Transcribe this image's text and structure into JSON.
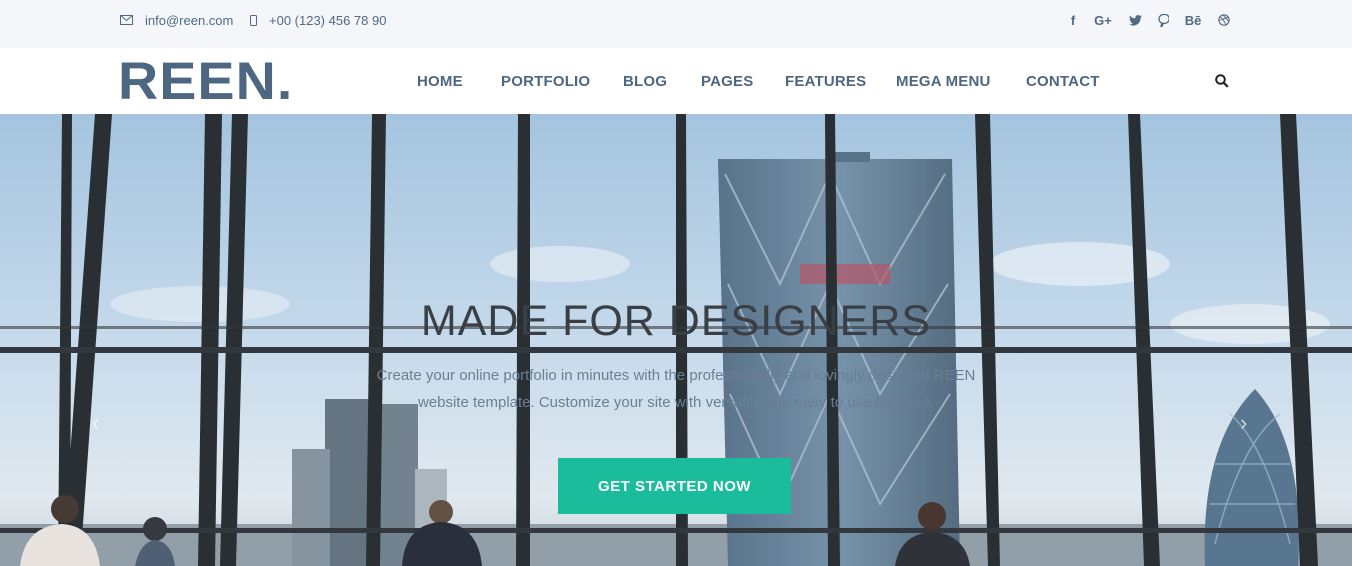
{
  "topbar": {
    "email": "info@reen.com",
    "phone": "+00 (123) 456 78 90",
    "social": [
      {
        "icon": "facebook-icon",
        "glyph": "f"
      },
      {
        "icon": "google-plus-icon",
        "glyph": "G+"
      },
      {
        "icon": "twitter-icon",
        "glyph": "t"
      },
      {
        "icon": "pinterest-icon",
        "glyph": "p"
      },
      {
        "icon": "behance-icon",
        "glyph": "Bē"
      },
      {
        "icon": "dribbble-icon",
        "glyph": "◎"
      }
    ]
  },
  "header": {
    "logo": "REEN.",
    "nav": [
      "HOME",
      "PORTFOLIO",
      "BLOG",
      "PAGES",
      "FEATURES",
      "MEGA MENU",
      "CONTACT"
    ],
    "search_icon": "search-icon"
  },
  "hero": {
    "title": "MADE FOR DESIGNERS",
    "subtitle": "Create your online portfolio in minutes with the professionally and lovingly designed REEN website template. Customize your site with versatile and easy to use features.",
    "cta": "GET STARTED NOW",
    "prev_icon": "chevron-left-icon",
    "next_icon": "chevron-right-icon"
  },
  "colors": {
    "brand": "#4d6783",
    "accent": "#1abc9c",
    "topbar_bg": "#f4f6f9"
  }
}
